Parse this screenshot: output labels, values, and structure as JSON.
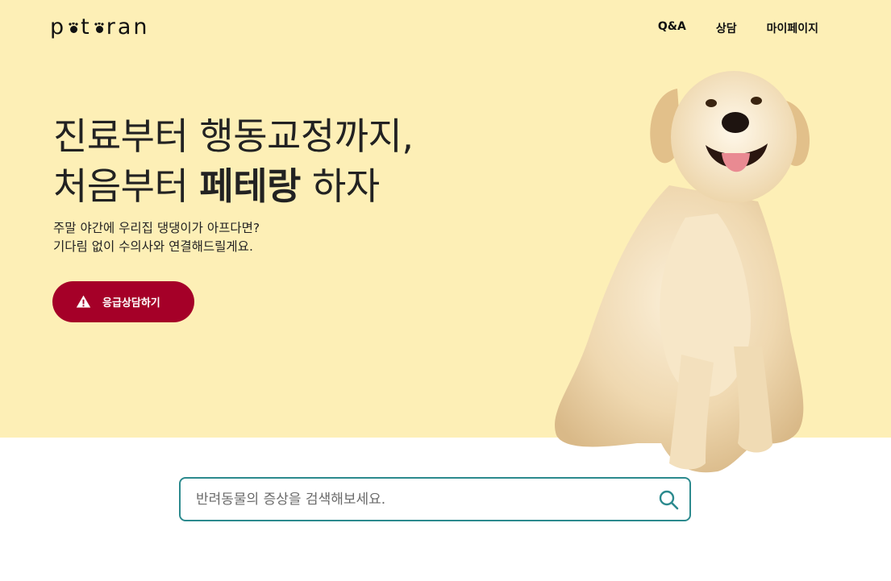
{
  "colors": {
    "hero_bg": "#fdefb6",
    "accent_red": "#a50028",
    "search_border": "#2c8a8e"
  },
  "header": {
    "logo_parts": [
      "p",
      "t",
      "ran"
    ],
    "nav": [
      {
        "label": "Q&A"
      },
      {
        "label": "상담"
      },
      {
        "label": "마이페이지"
      }
    ]
  },
  "hero": {
    "headline_line1": "진료부터 행동교정까지,",
    "headline_line2_prefix": "처음부터 ",
    "headline_line2_bold": "페테랑",
    "headline_line2_suffix": " 하자",
    "sub_line1": "주말 야간에 우리집 댕댕이가 아프다면?",
    "sub_line2": "기다림 없이 수의사와 연결해드릴게요.",
    "cta_label": "응급상담하기",
    "cta_icon": "warning-icon"
  },
  "search": {
    "placeholder": "반려동물의 증상을 검색해보세요.",
    "value": "",
    "icon": "search-icon"
  }
}
